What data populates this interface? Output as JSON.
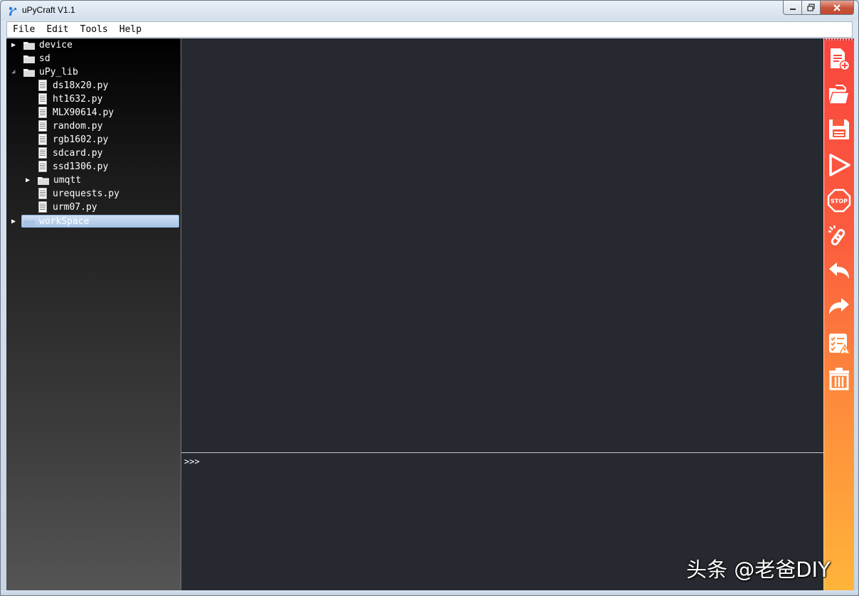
{
  "window": {
    "title": "uPyCraft V1.1",
    "controls": {
      "minimize": "minimize",
      "maximize": "maximize",
      "close": "close"
    }
  },
  "menu": [
    "File",
    "Edit",
    "Tools",
    "Help"
  ],
  "tree": {
    "device": "device",
    "sd": "sd",
    "upy_lib": "uPy_lib",
    "files": [
      "ds18x20.py",
      "ht1632.py",
      "MLX90614.py",
      "random.py",
      "rgb1602.py",
      "sdcard.py",
      "ssd1306.py"
    ],
    "umqtt": "umqtt",
    "files2": [
      "urequests.py",
      "urm07.py"
    ],
    "workspace": "workSpace"
  },
  "terminal": {
    "prompt": ">>>"
  },
  "toolbar": {
    "icons": [
      "new-file-icon",
      "open-folder-icon",
      "save-icon",
      "run-icon",
      "stop-icon",
      "connect-icon",
      "undo-icon",
      "redo-icon",
      "syntax-check-icon",
      "clear-icon"
    ],
    "stop_text": "STOP"
  },
  "watermark": "头条 @老爸DIY",
  "colors": {
    "editor_bg": "#262a30",
    "toolbar_top": "#f9463e",
    "toolbar_bottom": "#ffb43a",
    "selection": "#b9d1ee"
  }
}
